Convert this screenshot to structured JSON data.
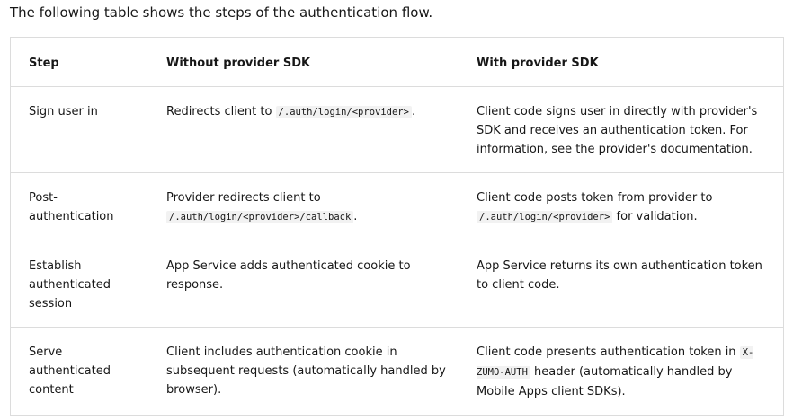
{
  "intro": "The following table shows the steps of the authentication flow.",
  "headers": {
    "step": "Step",
    "without": "Without provider SDK",
    "with": "With provider SDK"
  },
  "rows": [
    {
      "step": "Sign user in",
      "without_pre": "Redirects client to ",
      "without_code": "/.auth/login/<provider>",
      "without_post": ".",
      "with_text": "Client code signs user in directly with provider's SDK and receives an authentication token. For information, see the provider's documentation."
    },
    {
      "step": "Post-authentication",
      "without_text": "Provider redirects client to",
      "without_code": "/.auth/login/<provider>/callback",
      "without_post": ".",
      "with_text": "Client code posts token from provider to",
      "with_code": "/.auth/login/<provider>",
      "with_post": " for validation."
    },
    {
      "step": "Establish authenticated session",
      "without_text": "App Service adds authenticated cookie to response.",
      "with_text": "App Service returns its own authentication token to client code."
    },
    {
      "step": "Serve authenticated content",
      "without_text": "Client includes authentication cookie in subsequent requests (automatically handled by browser).",
      "with_pre": "Client code presents authentication token in ",
      "with_code": "X-ZUMO-AUTH",
      "with_post": " header (automatically handled by Mobile Apps client SDKs)."
    }
  ]
}
